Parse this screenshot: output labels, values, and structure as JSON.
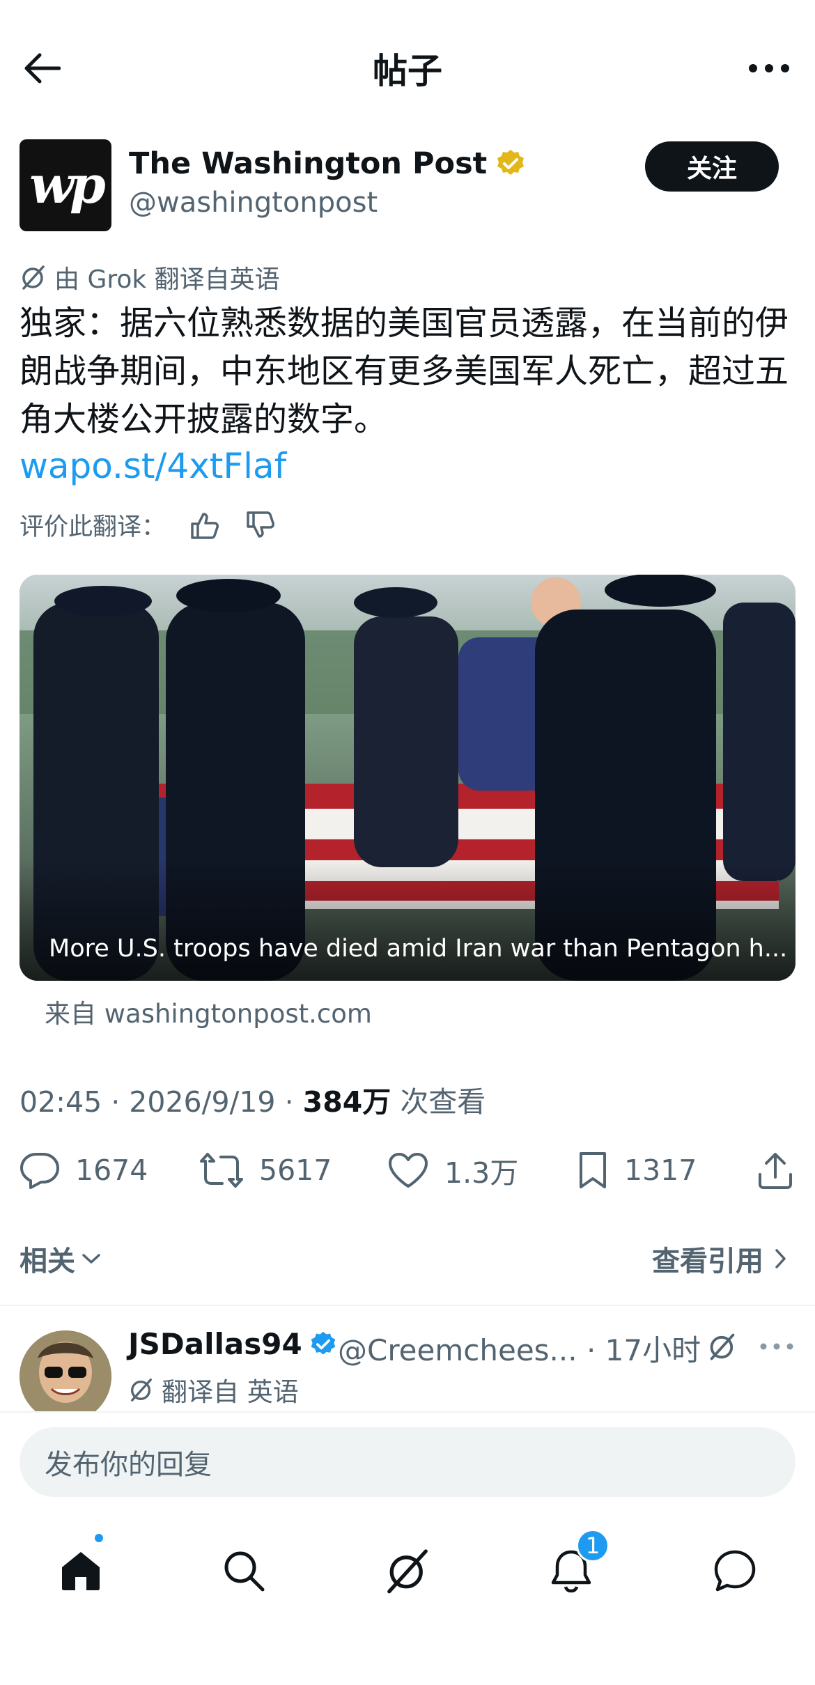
{
  "header": {
    "title": "帖子"
  },
  "author": {
    "name": "The Washington Post",
    "handle": "@washingtonpost",
    "logo_text": "wp",
    "follow_label": "关注"
  },
  "translation": {
    "label": "由 Grok 翻译自英语"
  },
  "tweet": {
    "text": "独家：据六位熟悉数据的美国官员透露，在当前的伊朗战争期间，中东地区有更多美国军人死亡，超过五角大楼公开披露的数字。",
    "link": "wapo.st/4xtFlaf"
  },
  "rate": {
    "label": "评价此翻译："
  },
  "media": {
    "caption": "More U.S. troops have died amid Iran war than Pentagon h...",
    "source": "来自 washingtonpost.com"
  },
  "meta": {
    "time": "02:45",
    "sep1": "·",
    "date": "2026/9/19",
    "sep2": "·",
    "views": "384万",
    "views_label": "次查看"
  },
  "actions": {
    "replies": "1674",
    "reposts": "5617",
    "likes": "1.3万",
    "bookmarks": "1317"
  },
  "related": {
    "label": "相关",
    "quotes_label": "查看引用"
  },
  "reply_preview": {
    "name": "JSDallas94",
    "handle": "@Creemchees...",
    "dot": "·",
    "time": "17小时",
    "translation": "翻译自 英语"
  },
  "composer": {
    "placeholder": "发布你的回复"
  },
  "nav": {
    "notification_count": "1"
  },
  "colors": {
    "accent": "#1d9bf0",
    "text": "#0f1419",
    "secondary": "#536471",
    "verified_gold": "#e2b719"
  }
}
